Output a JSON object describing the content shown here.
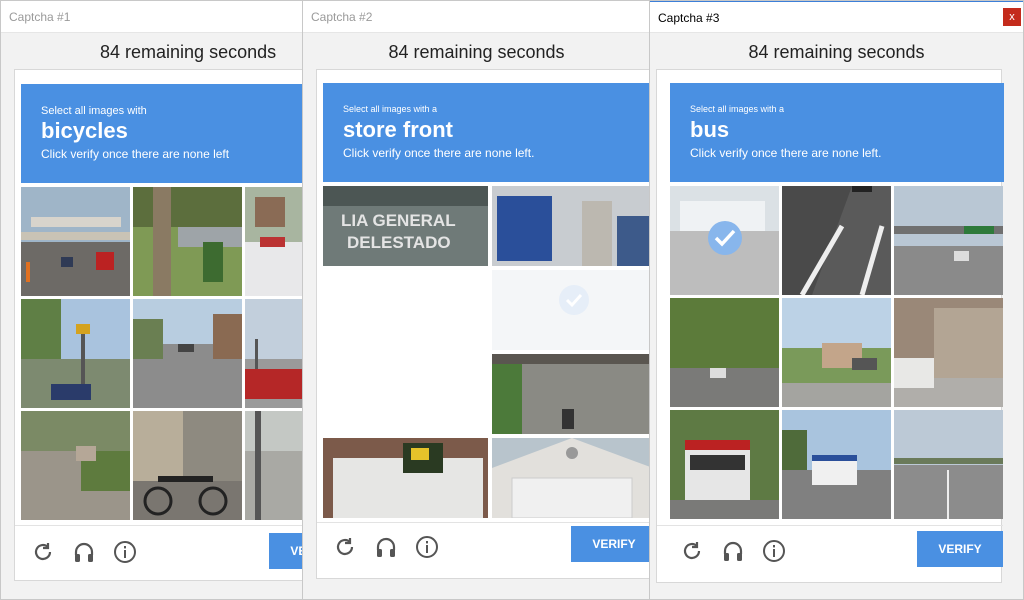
{
  "windows": [
    {
      "title": "Captcha #1",
      "timer": "84 remaining seconds",
      "prompt_line1": "Select all images with",
      "prompt_target": "bicycles",
      "prompt_line3": "Click verify once there are none left",
      "verify_label": "VERIFY"
    },
    {
      "title": "Captcha #2",
      "timer": "84 remaining seconds",
      "prompt_line1": "Select all images with a",
      "prompt_target": "store front",
      "prompt_line3": "Click verify once there are none left.",
      "verify_label": "VERIFY"
    },
    {
      "title": "Captcha #3",
      "timer": "84 remaining seconds",
      "prompt_line1": "Select all images with a",
      "prompt_target": "bus",
      "prompt_line3": "Click verify once there are none left.",
      "verify_label": "VERIFY",
      "close_label": "x"
    }
  ],
  "tile_text": {
    "sign_line1": "LIA GENERAL",
    "sign_line2": "DELESTADO"
  },
  "icons": [
    "reload-icon",
    "headphones-icon",
    "info-icon"
  ],
  "colors": {
    "accent": "#4a90e2",
    "close": "#c42b1c"
  }
}
